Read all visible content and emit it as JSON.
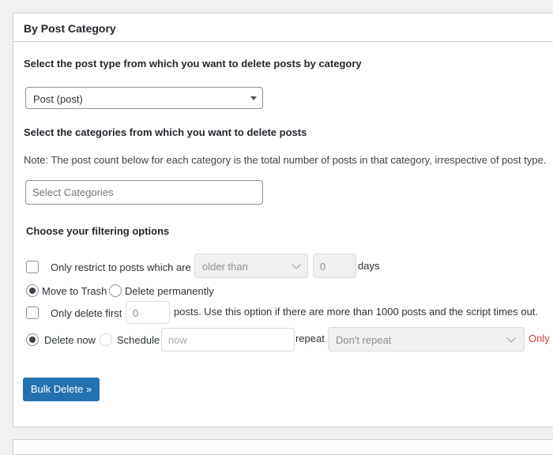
{
  "panel": {
    "title": "By Post Category",
    "post_type_prompt": "Select the post type from which you want to delete posts by category",
    "post_type_select": {
      "value": "Post (post)"
    },
    "categories_prompt": "Select the categories from which you want to delete posts",
    "note": "Note: The post count below for each category is the total number of posts in that category, irrespective of post type.",
    "categories_select": {
      "placeholder": "Select Categories"
    },
    "filter_heading": "Choose your filtering options",
    "restrict": {
      "label": "Only restrict to posts which are",
      "operator_value": "older than",
      "days_value": "0",
      "days_label": "days"
    },
    "trash_option": {
      "label": "Move to Trash",
      "selected": true
    },
    "permanent_option": {
      "label": "Delete permanently",
      "selected": false
    },
    "limit": {
      "label": "Only delete first",
      "count_value": "0",
      "hint": "posts. Use this option if there are more than 1000 posts and the script times out."
    },
    "schedule": {
      "delete_now_label": "Delete now",
      "schedule_label": "Schedule",
      "time_placeholder": "now",
      "repeat_label": "repeat",
      "repeat_value": "Don't repeat",
      "warning": "Only"
    },
    "bulk_delete_label": "Bulk Delete »"
  },
  "colors": {
    "primary_button": "#2271b1",
    "warning_text": "#d63638"
  }
}
